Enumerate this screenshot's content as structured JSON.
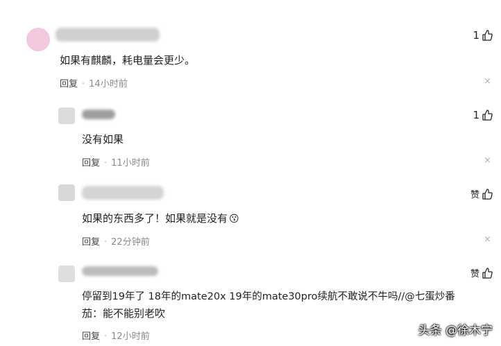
{
  "comments": [
    {
      "text": "如果有麒麟，耗电量会更少。",
      "reply": "回复",
      "time": "14小时前",
      "likes": "1",
      "close": "×"
    },
    {
      "text": "没有如果",
      "reply": "回复",
      "time": "11小时前",
      "likes": "1",
      "close": "×"
    },
    {
      "text": "如果的东西多了！如果就是没有",
      "emoji": "😗",
      "reply": "回复",
      "time": "22分钟前",
      "likes": "赞",
      "close": "×"
    },
    {
      "text_line1": "停留到19年了 18年的mate20x 19年的mate30pro续航不敢说不牛吗//@七蛋炒番",
      "text_line2": "茄：能不能别老吹",
      "reply": "回复",
      "time": "12小时前",
      "likes": "赞"
    }
  ],
  "separator": "·",
  "watermark": "头条 @徐木宁"
}
